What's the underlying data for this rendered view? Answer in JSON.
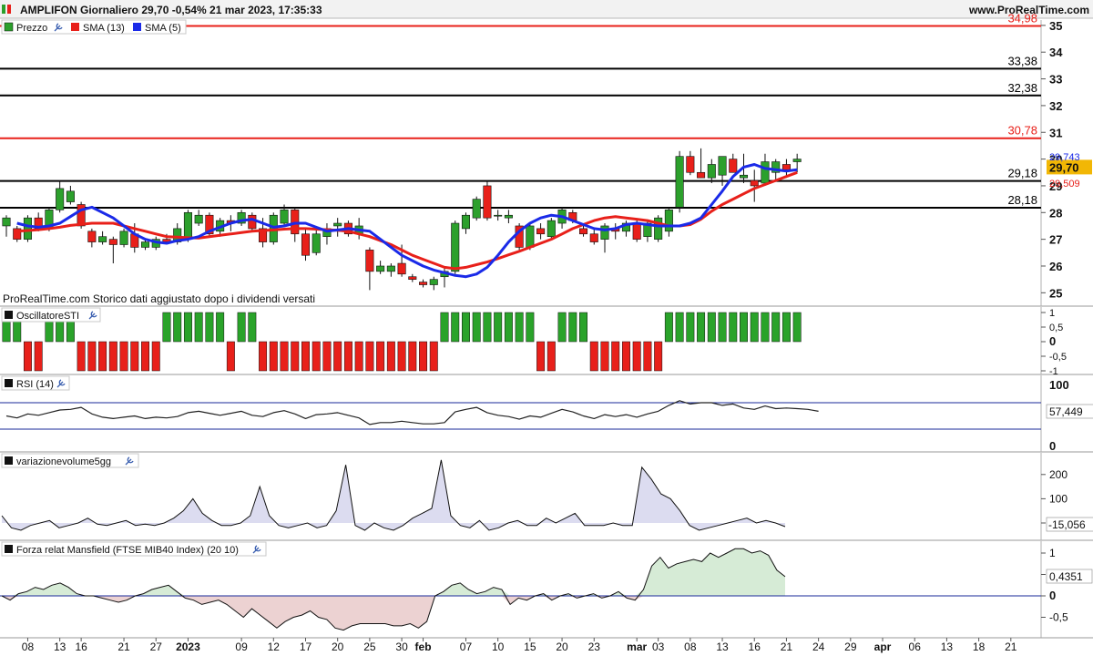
{
  "header": {
    "title": "AMPLIFON Giornaliero 29,70 -0,54% 21 mar 2023, 17:35:33",
    "site": "www.ProRealTime.com"
  },
  "colors": {
    "up": "#2ca02c",
    "down": "#e8201a",
    "sma13": "#e8201a",
    "sma5": "#1a2ae8",
    "level_red": "#e8201a",
    "level_black": "#000000",
    "osc_up": "#2aa32a",
    "osc_down": "#e8201a",
    "rsi": "#222222",
    "band": "#1a2a9a",
    "vol_fill": "#dcdcf0",
    "mans_pos": "#d6ebd6",
    "mans_neg": "#ecd2d2",
    "current_tag": "#f2b705"
  },
  "price_panel": {
    "legend": [
      "Prezzo",
      "SMA (13)",
      "SMA (5)"
    ],
    "note": "ProRealTime.com  Storico dati aggiustato dopo i dividendi versati",
    "current_price_label": "29,70",
    "sma13_value_label": "29,509",
    "sma5_value_label": "29,743",
    "yticks": [
      {
        "v": 25,
        "label": "25"
      },
      {
        "v": 26,
        "label": "26"
      },
      {
        "v": 27,
        "label": "27"
      },
      {
        "v": 28,
        "label": "28"
      },
      {
        "v": 29,
        "label": "29"
      },
      {
        "v": 30,
        "label": "30"
      },
      {
        "v": 31,
        "label": "31"
      },
      {
        "v": 32,
        "label": "32"
      },
      {
        "v": 33,
        "label": "33"
      },
      {
        "v": 34,
        "label": "34"
      },
      {
        "v": 35,
        "label": "35"
      }
    ],
    "levels": [
      {
        "v": 34.98,
        "label": "34,98",
        "kind": "red"
      },
      {
        "v": 33.38,
        "label": "33,38",
        "kind": "black"
      },
      {
        "v": 32.38,
        "label": "32,38",
        "kind": "black"
      },
      {
        "v": 30.78,
        "label": "30,78",
        "kind": "red"
      },
      {
        "v": 29.18,
        "label": "29,18",
        "kind": "black"
      },
      {
        "v": 28.18,
        "label": "28,18",
        "kind": "black"
      }
    ]
  },
  "chart_data": {
    "type": "candlestick",
    "title": "AMPLIFON Giornaliero",
    "x_labels": [
      {
        "i": 2,
        "label": "08"
      },
      {
        "i": 5,
        "label": "13"
      },
      {
        "i": 7,
        "label": "16"
      },
      {
        "i": 11,
        "label": "21"
      },
      {
        "i": 14,
        "label": "27"
      },
      {
        "i": 17,
        "label": "2023"
      },
      {
        "i": 22,
        "label": "09"
      },
      {
        "i": 25,
        "label": "12"
      },
      {
        "i": 28,
        "label": "17"
      },
      {
        "i": 31,
        "label": "20"
      },
      {
        "i": 34,
        "label": "25"
      },
      {
        "i": 37,
        "label": "30"
      },
      {
        "i": 39,
        "label": "feb"
      },
      {
        "i": 43,
        "label": "07"
      },
      {
        "i": 46,
        "label": "10"
      },
      {
        "i": 49,
        "label": "15"
      },
      {
        "i": 52,
        "label": "20"
      },
      {
        "i": 55,
        "label": "23"
      },
      {
        "i": 59,
        "label": "mar"
      },
      {
        "i": 61,
        "label": "03"
      },
      {
        "i": 64,
        "label": "08"
      },
      {
        "i": 67,
        "label": "13"
      },
      {
        "i": 70,
        "label": "16"
      },
      {
        "i": 73,
        "label": "21"
      },
      {
        "i": 76,
        "label": "24"
      },
      {
        "i": 79,
        "label": "29"
      },
      {
        "i": 82,
        "label": "apr"
      },
      {
        "i": 85,
        "label": "06"
      },
      {
        "i": 88,
        "label": "13"
      },
      {
        "i": 91,
        "label": "18"
      },
      {
        "i": 94,
        "label": "21"
      }
    ],
    "ohlc": [
      [
        27.5,
        27.9,
        27.1,
        27.8
      ],
      [
        27.4,
        27.5,
        26.9,
        27.0
      ],
      [
        27.0,
        27.9,
        26.9,
        27.8
      ],
      [
        27.8,
        28.0,
        27.3,
        27.4
      ],
      [
        27.4,
        28.2,
        27.3,
        28.1
      ],
      [
        28.1,
        29.2,
        28.0,
        28.9
      ],
      [
        28.4,
        29.0,
        28.3,
        28.8
      ],
      [
        28.3,
        28.4,
        27.4,
        27.5
      ],
      [
        27.3,
        27.4,
        26.7,
        26.9
      ],
      [
        26.9,
        27.3,
        26.8,
        27.1
      ],
      [
        27.0,
        27.1,
        26.1,
        26.8
      ],
      [
        26.8,
        27.4,
        26.7,
        27.3
      ],
      [
        27.2,
        27.6,
        26.5,
        26.7
      ],
      [
        26.7,
        27.0,
        26.6,
        26.9
      ],
      [
        26.7,
        27.1,
        26.6,
        27.0
      ],
      [
        27.0,
        27.2,
        26.8,
        26.9
      ],
      [
        26.9,
        27.6,
        26.8,
        27.4
      ],
      [
        27.0,
        28.1,
        26.9,
        28.0
      ],
      [
        27.6,
        28.1,
        27.5,
        27.9
      ],
      [
        27.9,
        28.0,
        27.1,
        27.2
      ],
      [
        27.3,
        27.8,
        27.1,
        27.7
      ],
      [
        27.7,
        27.9,
        27.3,
        27.6
      ],
      [
        27.6,
        28.1,
        27.5,
        28.0
      ],
      [
        27.9,
        28.0,
        27.3,
        27.4
      ],
      [
        27.4,
        27.8,
        26.7,
        26.9
      ],
      [
        26.9,
        28.0,
        26.8,
        27.9
      ],
      [
        27.6,
        28.3,
        27.5,
        28.1
      ],
      [
        28.1,
        28.2,
        26.9,
        27.2
      ],
      [
        27.2,
        27.4,
        26.2,
        26.4
      ],
      [
        26.5,
        27.5,
        26.4,
        27.2
      ],
      [
        27.1,
        27.6,
        26.8,
        27.4
      ],
      [
        27.5,
        27.8,
        27.1,
        27.6
      ],
      [
        27.6,
        27.7,
        27.1,
        27.2
      ],
      [
        27.2,
        27.8,
        27.0,
        27.5
      ],
      [
        26.6,
        26.7,
        25.1,
        25.8
      ],
      [
        25.8,
        26.2,
        25.7,
        26.0
      ],
      [
        25.8,
        26.1,
        25.6,
        26.0
      ],
      [
        26.1,
        26.8,
        25.6,
        25.7
      ],
      [
        25.6,
        25.7,
        25.4,
        25.5
      ],
      [
        25.4,
        25.5,
        25.2,
        25.3
      ],
      [
        25.3,
        25.6,
        25.1,
        25.5
      ],
      [
        25.6,
        26.0,
        25.2,
        25.8
      ],
      [
        25.8,
        27.7,
        25.7,
        27.6
      ],
      [
        27.4,
        28.0,
        27.2,
        27.9
      ],
      [
        27.8,
        28.6,
        27.7,
        28.5
      ],
      [
        29.0,
        29.2,
        27.7,
        27.8
      ],
      [
        27.9,
        28.1,
        27.7,
        27.9
      ],
      [
        27.8,
        28.1,
        27.6,
        27.9
      ],
      [
        27.5,
        27.6,
        26.6,
        26.7
      ],
      [
        26.7,
        27.6,
        26.6,
        27.5
      ],
      [
        27.4,
        27.6,
        27.0,
        27.2
      ],
      [
        27.1,
        27.8,
        27.0,
        27.7
      ],
      [
        27.6,
        28.2,
        27.4,
        28.1
      ],
      [
        28.0,
        28.1,
        27.6,
        27.7
      ],
      [
        27.4,
        27.6,
        27.1,
        27.2
      ],
      [
        27.2,
        27.4,
        26.8,
        26.9
      ],
      [
        27.0,
        27.6,
        26.5,
        27.5
      ],
      [
        27.4,
        27.6,
        27.0,
        27.3
      ],
      [
        27.3,
        27.7,
        27.1,
        27.6
      ],
      [
        27.6,
        27.7,
        26.9,
        27.0
      ],
      [
        27.1,
        27.7,
        26.9,
        27.6
      ],
      [
        27.0,
        27.9,
        26.9,
        27.8
      ],
      [
        27.3,
        28.2,
        27.1,
        28.1
      ],
      [
        28.2,
        30.3,
        28.0,
        30.1
      ],
      [
        30.1,
        30.3,
        29.4,
        29.5
      ],
      [
        29.5,
        30.4,
        29.3,
        29.3
      ],
      [
        29.3,
        30.0,
        29.1,
        29.8
      ],
      [
        29.4,
        30.1,
        29.0,
        30.1
      ],
      [
        30.0,
        30.2,
        29.5,
        29.5
      ],
      [
        29.3,
        30.2,
        29.1,
        29.4
      ],
      [
        29.2,
        29.6,
        28.4,
        29.0
      ],
      [
        29.1,
        30.2,
        29.0,
        29.9
      ],
      [
        29.5,
        30.0,
        29.2,
        29.9
      ],
      [
        29.8,
        30.0,
        29.3,
        29.6
      ],
      [
        29.9,
        30.2,
        29.5,
        30.0
      ]
    ],
    "sma13": [
      27.3,
      27.33,
      27.36,
      27.4,
      27.45,
      27.52,
      27.56,
      27.6,
      27.6,
      27.6,
      27.5,
      27.4,
      27.3,
      27.2,
      27.1,
      27.08,
      27.06,
      27.05,
      27.1,
      27.15,
      27.2,
      27.25,
      27.3,
      27.33,
      27.35,
      27.38,
      27.4,
      27.4,
      27.38,
      27.36,
      27.34,
      27.3,
      27.2,
      27.1,
      26.95,
      26.8,
      26.6,
      26.4,
      26.25,
      26.1,
      25.95,
      25.9,
      25.95,
      26.05,
      26.15,
      26.28,
      26.42,
      26.55,
      26.7,
      26.85,
      27.0,
      27.2,
      27.4,
      27.55,
      27.7,
      27.8,
      27.85,
      27.8,
      27.75,
      27.7,
      27.6,
      27.5,
      27.5,
      27.55,
      27.75,
      28.05,
      28.3,
      28.5,
      28.7,
      28.9,
      29.05,
      29.2,
      29.35,
      29.5
    ],
    "sma5": [
      27.6,
      27.5,
      27.45,
      27.5,
      27.6,
      27.85,
      28.1,
      28.2,
      28.0,
      27.8,
      27.5,
      27.2,
      27.0,
      26.9,
      26.85,
      26.95,
      27.0,
      27.1,
      27.3,
      27.45,
      27.6,
      27.7,
      27.75,
      27.6,
      27.45,
      27.5,
      27.6,
      27.6,
      27.45,
      27.3,
      27.35,
      27.4,
      27.35,
      27.3,
      27.0,
      26.7,
      26.4,
      26.2,
      26.0,
      25.85,
      25.75,
      25.65,
      25.6,
      25.7,
      25.95,
      26.4,
      26.9,
      27.3,
      27.6,
      27.8,
      27.9,
      27.85,
      27.7,
      27.55,
      27.4,
      27.35,
      27.4,
      27.55,
      27.6,
      27.55,
      27.5,
      27.5,
      27.5,
      27.6,
      27.8,
      28.3,
      28.8,
      29.35,
      29.7,
      29.8,
      29.65,
      29.6,
      29.55,
      29.6
    ],
    "ylim": [
      24.5,
      35.2
    ]
  },
  "osc_panel": {
    "title": "OscillatoreSTI",
    "yticks": [
      {
        "v": 1,
        "label": "1"
      },
      {
        "v": 0.5,
        "label": "0,5"
      },
      {
        "v": 0,
        "label": "0"
      },
      {
        "v": -0.5,
        "label": "-0,5"
      },
      {
        "v": -1,
        "label": "-1"
      }
    ],
    "values": [
      1,
      1,
      -1,
      -1,
      1,
      1,
      1,
      -1,
      -1,
      -1,
      -1,
      -1,
      -1,
      -1,
      -1,
      1,
      1,
      1,
      1,
      1,
      1,
      -1,
      1,
      1,
      -1,
      -1,
      -1,
      -1,
      -1,
      -1,
      -1,
      -1,
      -1,
      -1,
      -1,
      -1,
      -1,
      -1,
      -1,
      -1,
      -1,
      1,
      1,
      1,
      1,
      1,
      1,
      1,
      1,
      1,
      -1,
      -1,
      1,
      1,
      1,
      -1,
      -1,
      -1,
      -1,
      -1,
      -1,
      -1,
      1,
      1,
      1,
      1,
      1,
      1,
      1,
      1,
      1,
      1,
      1,
      1,
      1
    ]
  },
  "rsi_panel": {
    "title": "RSI (14)",
    "value_label": "57,449",
    "yticks": [
      {
        "v": 100,
        "label": "100"
      },
      {
        "v": 0,
        "label": "0"
      }
    ],
    "band_upper": 70,
    "band_lower": 30,
    "values": [
      50,
      47,
      53,
      51,
      55,
      59,
      60,
      63,
      53,
      48,
      46,
      48,
      50,
      46,
      48,
      47,
      49,
      55,
      57,
      54,
      51,
      54,
      57,
      51,
      49,
      55,
      58,
      53,
      46,
      52,
      53,
      55,
      51,
      47,
      37,
      40,
      40,
      42,
      40,
      38,
      38,
      40,
      56,
      60,
      63,
      55,
      51,
      49,
      45,
      50,
      48,
      54,
      60,
      56,
      50,
      46,
      52,
      49,
      52,
      48,
      53,
      57,
      66,
      73,
      68,
      70,
      70,
      66,
      68,
      62,
      60,
      65,
      61,
      62,
      61,
      60,
      57
    ]
  },
  "vol_panel": {
    "title": "variazionevolume5gg",
    "value_label": "-15,056",
    "yticks": [
      {
        "v": 200,
        "label": "200"
      },
      {
        "v": 100,
        "label": "100"
      },
      {
        "v": 0,
        "label": "0"
      }
    ],
    "values": [
      30,
      -20,
      -30,
      -10,
      0,
      10,
      -20,
      -10,
      0,
      20,
      -5,
      -10,
      0,
      10,
      -10,
      -5,
      -10,
      0,
      20,
      50,
      100,
      40,
      10,
      -10,
      -10,
      0,
      30,
      150,
      30,
      -10,
      -20,
      -10,
      0,
      -20,
      -10,
      50,
      240,
      -10,
      -30,
      0,
      -20,
      -30,
      -10,
      20,
      40,
      60,
      260,
      30,
      -10,
      -20,
      10,
      -30,
      -20,
      0,
      10,
      -10,
      -10,
      20,
      0,
      20,
      40,
      -10,
      -10,
      -10,
      0,
      -10,
      -10,
      230,
      180,
      120,
      100,
      50,
      -10,
      -30,
      -20,
      -10,
      0,
      10,
      20,
      0,
      10,
      0,
      -15
    ]
  },
  "mans_panel": {
    "title": "Forza relat Mansfield (FTSE MIB40 Index) (20 10)",
    "value_label": "0,4351",
    "yticks": [
      {
        "v": 1,
        "label": "1"
      },
      {
        "v": 0.5,
        "label": ""
      },
      {
        "v": 0,
        "label": "0"
      },
      {
        "v": -0.5,
        "label": "-0,5"
      }
    ],
    "values": [
      0.0,
      -0.1,
      0.05,
      0.1,
      0.2,
      0.15,
      0.25,
      0.3,
      0.2,
      0.05,
      0.0,
      0.0,
      -0.05,
      -0.1,
      -0.15,
      -0.1,
      0.0,
      0.05,
      0.15,
      0.2,
      0.25,
      0.1,
      -0.05,
      -0.1,
      -0.2,
      -0.15,
      -0.1,
      -0.2,
      -0.35,
      -0.5,
      -0.3,
      -0.45,
      -0.6,
      -0.75,
      -0.6,
      -0.5,
      -0.45,
      -0.35,
      -0.5,
      -0.55,
      -0.75,
      -0.8,
      -0.7,
      -0.65,
      -0.65,
      -0.65,
      -0.65,
      -0.7,
      -0.7,
      -0.65,
      -0.75,
      -0.6,
      0.0,
      0.1,
      0.25,
      0.3,
      0.15,
      0.05,
      0.1,
      0.2,
      0.15,
      -0.2,
      -0.05,
      -0.1,
      0.0,
      0.05,
      -0.1,
      0.0,
      0.05,
      -0.05,
      0.0,
      0.05,
      -0.05,
      0.0,
      0.1,
      -0.05,
      -0.1,
      0.15,
      0.7,
      0.9,
      0.65,
      0.75,
      0.8,
      0.85,
      0.8,
      1.0,
      0.9,
      1.0,
      1.1,
      1.1,
      1.0,
      1.05,
      0.95,
      0.6,
      0.45
    ]
  },
  "x_axis": {
    "n_slots": 97
  }
}
